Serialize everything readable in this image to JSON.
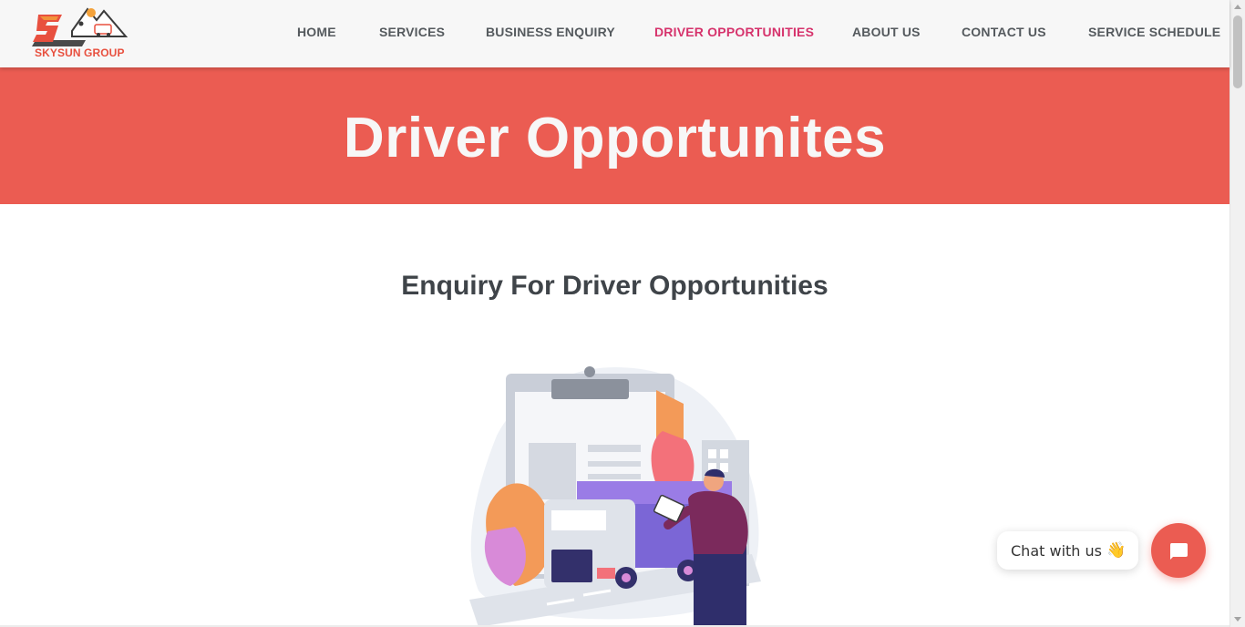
{
  "brand": {
    "name": "SKYSUN GROUP",
    "accent": "#eb5c52",
    "nav_active_color": "#d6336c"
  },
  "nav": {
    "items": [
      {
        "label": "HOME",
        "active": false
      },
      {
        "label": "SERVICES",
        "active": false
      },
      {
        "label": "BUSINESS ENQUIRY",
        "active": false
      },
      {
        "label": "DRIVER OPPORTUNITIES",
        "active": true
      },
      {
        "label": "ABOUT US",
        "active": false
      },
      {
        "label": "CONTACT US",
        "active": false
      },
      {
        "label": "SERVICE SCHEDULE",
        "active": false
      }
    ]
  },
  "banner": {
    "title": "Driver Opportunites"
  },
  "section": {
    "title": "Enquiry For Driver Opportunities"
  },
  "chat": {
    "label": "Chat with us",
    "emoji": "👋",
    "icon": "chat-icon"
  }
}
